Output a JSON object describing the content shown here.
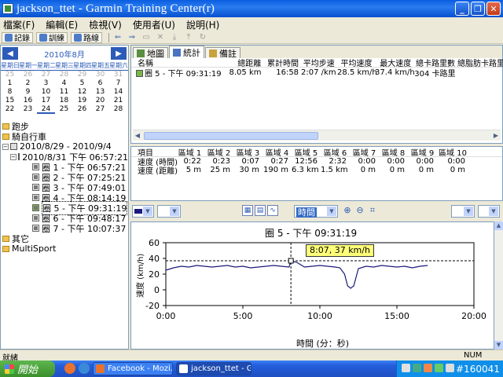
{
  "window": {
    "title": "jackson_ttet - Garmin Training Center(r)"
  },
  "menu": {
    "items": [
      "檔案(F)",
      "編輯(E)",
      "檢視(V)",
      "使用者(U)",
      "說明(H)"
    ]
  },
  "toolbar": {
    "buttons": [
      "記錄",
      "訓練",
      "路線"
    ]
  },
  "calendar": {
    "month_label": "2010年8月",
    "weekdays": [
      "星期日",
      "星期一",
      "星期二",
      "星期三",
      "星期四",
      "星期五",
      "星期六"
    ],
    "rows": [
      [
        "25",
        "26",
        "27",
        "28",
        "29",
        "30",
        "31"
      ],
      [
        "1",
        "2",
        "3",
        "4",
        "5",
        "6",
        "7"
      ],
      [
        "8",
        "9",
        "10",
        "11",
        "12",
        "13",
        "14"
      ],
      [
        "15",
        "16",
        "17",
        "18",
        "19",
        "20",
        "21"
      ],
      [
        "22",
        "23",
        "24",
        "25",
        "26",
        "27",
        "28"
      ]
    ]
  },
  "tree": {
    "running": "跑步",
    "cycling": "騎自行車",
    "range": "2010/8/29 - 2010/9/4",
    "activity": "2010/8/31 下午 06:57:21",
    "laps": [
      "圈 1 - 下午 06:57:21",
      "圈 2 - 下午 07:25:21",
      "圈 3 - 下午 07:49:01",
      "圈 4 - 下午 08:14:19",
      "圈 5 - 下午 09:31:19",
      "圈 6 - 下午 09:48:17",
      "圈 7 - 下午 10:07:37"
    ],
    "other": "其它",
    "multisport": "MultiSport"
  },
  "tabs": [
    "地圖",
    "統計",
    "備註"
  ],
  "stats": {
    "headers": [
      "名稱",
      "總距離",
      "累計時間",
      "平均步速",
      "平均速度",
      "最大速度",
      "總卡路里數",
      "總脂肪卡路里數"
    ],
    "row": [
      "圈 5 - 下午 09:31:19",
      "8.05 km",
      "16:58",
      "2:07 /km",
      "28.5 km/h",
      "37.4 km/h",
      "304 卡路里",
      ""
    ]
  },
  "laps_table": {
    "headers": [
      "項目",
      "區域 1",
      "區域 2",
      "區域 3",
      "區域 4",
      "區域 5",
      "區域 6",
      "區域 7",
      "區域 8",
      "區域 9",
      "區域 10"
    ],
    "rows": [
      [
        "速度 (時間)",
        "0:22",
        "0:23",
        "0:07",
        "0:27",
        "12:56",
        "2:32",
        "0:00",
        "0:00",
        "0:00",
        "0:00"
      ],
      [
        "速度 (距離)",
        "5 m",
        "25 m",
        "30 m",
        "190 m",
        "6.3 km",
        "1.5 km",
        "0 m",
        "0 m",
        "0 m",
        "0 m"
      ]
    ]
  },
  "chart_toolbar": {
    "x_axis_select": "時間"
  },
  "chart_data": {
    "type": "line",
    "title": "圈 5 - 下午 09:31:19",
    "xlabel": "時間 (分：秒)",
    "ylabel": "速度 (km/h)",
    "x_ticks": [
      "0:00",
      "5:00",
      "10:00",
      "15:00",
      "20:00"
    ],
    "y_ticks": [
      "-20",
      "0",
      "20",
      "40",
      "60"
    ],
    "xlim_min": [
      0,
      20
    ],
    "ylim": [
      -20,
      60
    ],
    "reference_y": 37,
    "cursor": {
      "x_min": 8.12,
      "y": 37,
      "label": "8:07, 37 km/h"
    },
    "series": [
      {
        "color": "#1a1a7a",
        "x_min": [
          0,
          0.5,
          1,
          1.5,
          2,
          2.5,
          3,
          3.5,
          4,
          4.5,
          5,
          5.5,
          6,
          6.5,
          7,
          7.5,
          8,
          8.12,
          8.5,
          9,
          9.5,
          10,
          10.5,
          11,
          11.3,
          11.6,
          11.8,
          12,
          12.2,
          12.5,
          13,
          13.5,
          14,
          14.5,
          15,
          15.5,
          16,
          16.5,
          17
        ],
        "values": [
          25,
          28,
          30,
          29,
          31,
          30,
          29,
          30,
          31,
          29,
          30,
          28,
          29,
          30,
          31,
          30,
          29,
          37,
          35,
          29,
          30,
          31,
          30,
          29,
          28,
          20,
          5,
          2,
          5,
          27,
          30,
          29,
          31,
          30,
          29,
          30,
          28,
          30,
          31
        ]
      }
    ]
  },
  "statusbar": {
    "left": "就緒",
    "right": "NUM"
  },
  "taskbar": {
    "start": "開始",
    "items": [
      "Facebook - Mozi...",
      "jackson_ttet - Ga..."
    ],
    "watermark": "#160041"
  }
}
